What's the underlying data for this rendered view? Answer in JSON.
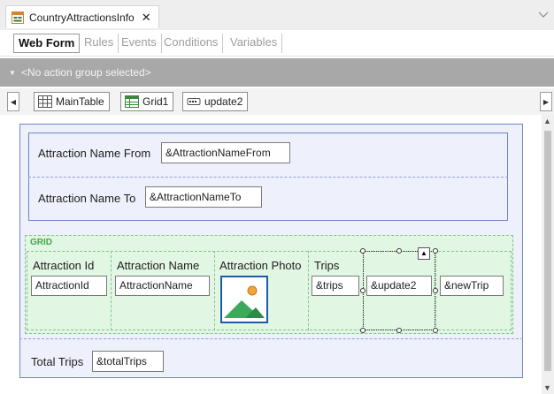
{
  "document_tab": {
    "title": "CountryAttractionsInfo",
    "close": "✕"
  },
  "sub_tabs": [
    "Web Form",
    "Rules",
    "Events",
    "Conditions",
    "Variables"
  ],
  "action_group": {
    "label": "<No action group selected>"
  },
  "breadcrumb": {
    "items": [
      "MainTable",
      "Grid1",
      "update2"
    ]
  },
  "form": {
    "attraction_name_from": {
      "label": "Attraction Name From",
      "value": "&AttractionNameFrom"
    },
    "attraction_name_to": {
      "label": "Attraction Name To",
      "value": "&AttractionNameTo"
    },
    "grid": {
      "caption": "GRID",
      "columns": [
        {
          "header": "Attraction Id",
          "value": "AttractionId"
        },
        {
          "header": "Attraction Name",
          "value": "AttractionName"
        },
        {
          "header": "Attraction Photo",
          "value": ""
        },
        {
          "header": "Trips",
          "value": "&trips"
        },
        {
          "header": "",
          "value": "&update2"
        },
        {
          "header": "",
          "value": "&newTrip"
        }
      ]
    },
    "total_trips": {
      "label": "Total Trips",
      "value": "&totalTrips"
    }
  },
  "colors": {
    "table_border": "#6b86c7",
    "table_fill": "#eef1fb",
    "grid_fill": "#e1f6e3",
    "grid_caption": "#3ea84f",
    "action_bar": "#a8a8a8"
  }
}
